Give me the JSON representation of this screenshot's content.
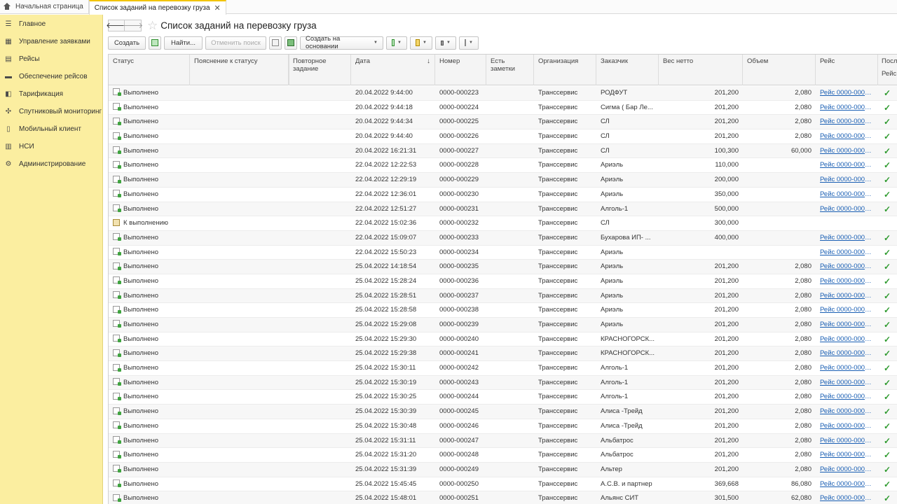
{
  "tabs": [
    {
      "label": "Начальная страница"
    },
    {
      "label": "Список заданий на перевозку груза"
    }
  ],
  "sidebar": {
    "items": [
      {
        "label": "Главное",
        "icon": "menu-icon"
      },
      {
        "label": "Управление заявками",
        "icon": "grid-icon"
      },
      {
        "label": "Рейсы",
        "icon": "calendar-icon"
      },
      {
        "label": "Обеспечение рейсов",
        "icon": "truck-icon"
      },
      {
        "label": "Тарификация",
        "icon": "tariff-icon"
      },
      {
        "label": "Спутниковый мониторинг",
        "icon": "satellite-icon"
      },
      {
        "label": "Мобильный клиент",
        "icon": "phone-icon"
      },
      {
        "label": "НСИ",
        "icon": "book-icon"
      },
      {
        "label": "Администрирование",
        "icon": "gear-icon"
      }
    ]
  },
  "page": {
    "title": "Список заданий на перевозку груза"
  },
  "toolbar": {
    "create": "Создать",
    "find": "Найти...",
    "cancel_search": "Отменить поиск",
    "create_based": "Создать на основании"
  },
  "columns": {
    "status": "Статус",
    "status_note": "Пояснение к статусу",
    "repeat": "Повторное задание",
    "date": "Дата",
    "number": "Номер",
    "notes": "Есть заметки",
    "org": "Организация",
    "customer": "Заказчик",
    "weight": "Вес нетто",
    "volume": "Объем",
    "trip": "Рейс",
    "last_top": "Посл",
    "last_bottom": "Рейс"
  },
  "rows": [
    {
      "status": "Выполнено",
      "date": "20.04.2022 9:44:00",
      "number": "0000-000223",
      "org": "Транссервис",
      "customer": "РОДФУТ",
      "weight": "201,200",
      "volume": "2,080",
      "trip": "Рейс 0000-0000...",
      "check": true
    },
    {
      "status": "Выполнено",
      "date": "20.04.2022 9:44:18",
      "number": "0000-000224",
      "org": "Транссервис",
      "customer": "Сигма ( Бар Ле...",
      "weight": "201,200",
      "volume": "2,080",
      "trip": "Рейс 0000-0000...",
      "check": true
    },
    {
      "status": "Выполнено",
      "date": "20.04.2022 9:44:34",
      "number": "0000-000225",
      "org": "Транссервис",
      "customer": "СЛ",
      "weight": "201,200",
      "volume": "2,080",
      "trip": "Рейс 0000-0000...",
      "check": true
    },
    {
      "status": "Выполнено",
      "date": "20.04.2022 9:44:40",
      "number": "0000-000226",
      "org": "Транссервис",
      "customer": "СЛ",
      "weight": "201,200",
      "volume": "2,080",
      "trip": "Рейс 0000-0000...",
      "check": true
    },
    {
      "status": "Выполнено",
      "date": "20.04.2022 16:21:31",
      "number": "0000-000227",
      "org": "Транссервис",
      "customer": "СЛ",
      "weight": "100,300",
      "volume": "60,000",
      "trip": "Рейс 0000-0000...",
      "check": true
    },
    {
      "status": "Выполнено",
      "date": "22.04.2022 12:22:53",
      "number": "0000-000228",
      "org": "Транссервис",
      "customer": "Ариэль",
      "weight": "110,000",
      "volume": "",
      "trip": "Рейс 0000-0000...",
      "check": true
    },
    {
      "status": "Выполнено",
      "date": "22.04.2022 12:29:19",
      "number": "0000-000229",
      "org": "Транссервис",
      "customer": "Ариэль",
      "weight": "200,000",
      "volume": "",
      "trip": "Рейс 0000-0000...",
      "check": true
    },
    {
      "status": "Выполнено",
      "date": "22.04.2022 12:36:01",
      "number": "0000-000230",
      "org": "Транссервис",
      "customer": "Ариэль",
      "weight": "350,000",
      "volume": "",
      "trip": "Рейс 0000-0000...",
      "check": true
    },
    {
      "status": "Выполнено",
      "date": "22.04.2022 12:51:27",
      "number": "0000-000231",
      "org": "Транссервис",
      "customer": "Алголь-1",
      "weight": "500,000",
      "volume": "",
      "trip": "Рейс 0000-0000...",
      "check": true
    },
    {
      "status": "К выполнению",
      "date": "22.04.2022 15:02:36",
      "number": "0000-000232",
      "org": "Транссервис",
      "customer": "СЛ",
      "weight": "300,000",
      "volume": "",
      "trip": "",
      "check": false
    },
    {
      "status": "Выполнено",
      "date": "22.04.2022 15:09:07",
      "number": "0000-000233",
      "org": "Транссервис",
      "customer": " Бухарова ИП- ...",
      "weight": "400,000",
      "volume": "",
      "trip": "Рейс 0000-0000...",
      "check": true
    },
    {
      "status": "Выполнено",
      "date": "22.04.2022 15:50:23",
      "number": "0000-000234",
      "org": "Транссервис",
      "customer": "Ариэль",
      "weight": "",
      "volume": "",
      "trip": "Рейс 0000-0000...",
      "check": true
    },
    {
      "status": "Выполнено",
      "date": "25.04.2022 14:18:54",
      "number": "0000-000235",
      "org": "Транссервис",
      "customer": "Ариэль",
      "weight": "201,200",
      "volume": "2,080",
      "trip": "Рейс 0000-0000...",
      "check": true
    },
    {
      "status": "Выполнено",
      "date": "25.04.2022 15:28:24",
      "number": "0000-000236",
      "org": "Транссервис",
      "customer": "Ариэль",
      "weight": "201,200",
      "volume": "2,080",
      "trip": "Рейс 0000-0000...",
      "check": true
    },
    {
      "status": "Выполнено",
      "date": "25.04.2022 15:28:51",
      "number": "0000-000237",
      "org": "Транссервис",
      "customer": "Ариэль",
      "weight": "201,200",
      "volume": "2,080",
      "trip": "Рейс 0000-0000...",
      "check": true
    },
    {
      "status": "Выполнено",
      "date": "25.04.2022 15:28:58",
      "number": "0000-000238",
      "org": "Транссервис",
      "customer": "Ариэль",
      "weight": "201,200",
      "volume": "2,080",
      "trip": "Рейс 0000-0000...",
      "check": true
    },
    {
      "status": "Выполнено",
      "date": "25.04.2022 15:29:08",
      "number": "0000-000239",
      "org": "Транссервис",
      "customer": "Ариэль",
      "weight": "201,200",
      "volume": "2,080",
      "trip": "Рейс 0000-0000...",
      "check": true
    },
    {
      "status": "Выполнено",
      "date": "25.04.2022 15:29:30",
      "number": "0000-000240",
      "org": "Транссервис",
      "customer": "КРАСНОГОРСК...",
      "weight": "201,200",
      "volume": "2,080",
      "trip": "Рейс 0000-0000...",
      "check": true
    },
    {
      "status": "Выполнено",
      "date": "25.04.2022 15:29:38",
      "number": "0000-000241",
      "org": "Транссервис",
      "customer": "КРАСНОГОРСК...",
      "weight": "201,200",
      "volume": "2,080",
      "trip": "Рейс 0000-0000...",
      "check": true
    },
    {
      "status": "Выполнено",
      "date": "25.04.2022 15:30:11",
      "number": "0000-000242",
      "org": "Транссервис",
      "customer": "Алголь-1",
      "weight": "201,200",
      "volume": "2,080",
      "trip": "Рейс 0000-0000...",
      "check": true
    },
    {
      "status": "Выполнено",
      "date": "25.04.2022 15:30:19",
      "number": "0000-000243",
      "org": "Транссервис",
      "customer": "Алголь-1",
      "weight": "201,200",
      "volume": "2,080",
      "trip": "Рейс 0000-0000...",
      "check": true
    },
    {
      "status": "Выполнено",
      "date": "25.04.2022 15:30:25",
      "number": "0000-000244",
      "org": "Транссервис",
      "customer": "Алголь-1",
      "weight": "201,200",
      "volume": "2,080",
      "trip": "Рейс 0000-0000...",
      "check": true
    },
    {
      "status": "Выполнено",
      "date": "25.04.2022 15:30:39",
      "number": "0000-000245",
      "org": "Транссервис",
      "customer": "Алиса -Трейд",
      "weight": "201,200",
      "volume": "2,080",
      "trip": "Рейс 0000-0000...",
      "check": true
    },
    {
      "status": "Выполнено",
      "date": "25.04.2022 15:30:48",
      "number": "0000-000246",
      "org": "Транссервис",
      "customer": "Алиса -Трейд",
      "weight": "201,200",
      "volume": "2,080",
      "trip": "Рейс 0000-0000...",
      "check": true
    },
    {
      "status": "Выполнено",
      "date": "25.04.2022 15:31:11",
      "number": "0000-000247",
      "org": "Транссервис",
      "customer": "Альбатрос",
      "weight": "201,200",
      "volume": "2,080",
      "trip": "Рейс 0000-0000...",
      "check": true
    },
    {
      "status": "Выполнено",
      "date": "25.04.2022 15:31:20",
      "number": "0000-000248",
      "org": "Транссервис",
      "customer": "Альбатрос",
      "weight": "201,200",
      "volume": "2,080",
      "trip": "Рейс 0000-0000...",
      "check": true
    },
    {
      "status": "Выполнено",
      "date": "25.04.2022 15:31:39",
      "number": "0000-000249",
      "org": "Транссервис",
      "customer": "Альтер",
      "weight": "201,200",
      "volume": "2,080",
      "trip": "Рейс 0000-0000...",
      "check": true
    },
    {
      "status": "Выполнено",
      "date": "25.04.2022 15:45:45",
      "number": "0000-000250",
      "org": "Транссервис",
      "customer": "А.С.В. и партнер",
      "weight": "369,668",
      "volume": "86,080",
      "trip": "Рейс 0000-0000...",
      "check": true
    },
    {
      "status": "Выполнено",
      "date": "25.04.2022 15:48:01",
      "number": "0000-000251",
      "org": "Транссервис",
      "customer": "Альянс СИТ",
      "weight": "301,500",
      "volume": "62,080",
      "trip": "Рейс 0000-0000...",
      "check": true
    }
  ]
}
